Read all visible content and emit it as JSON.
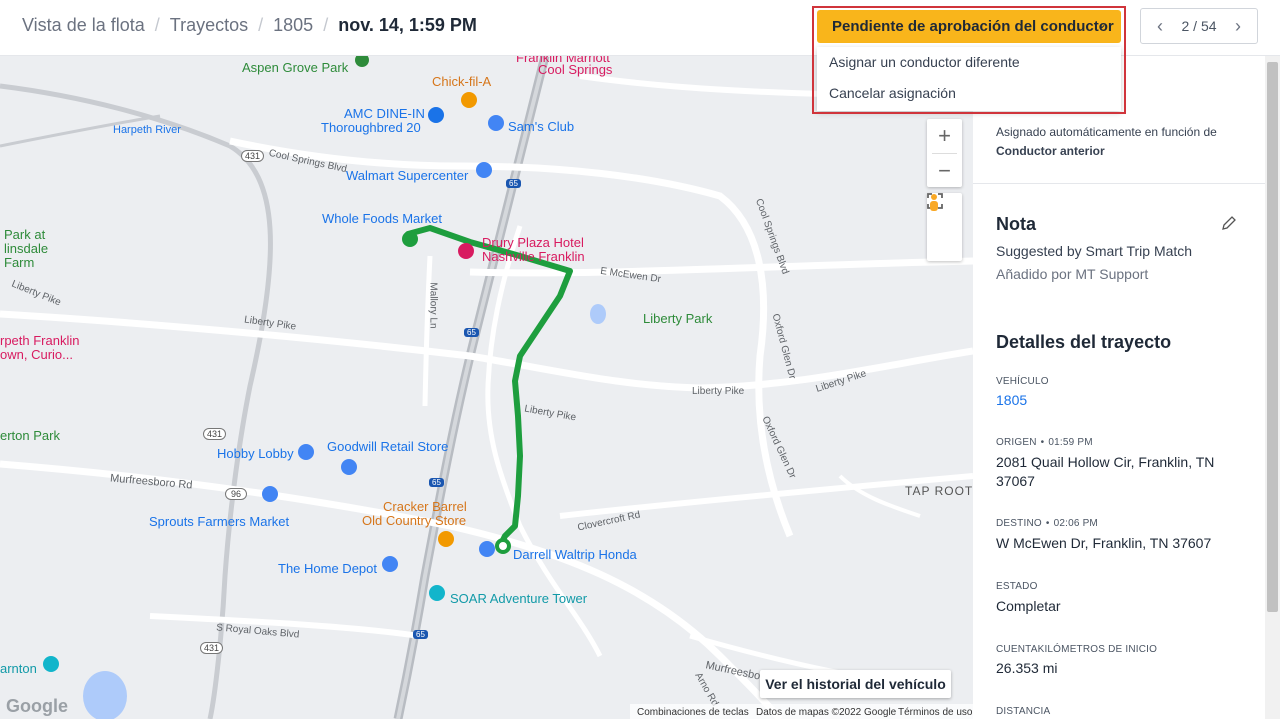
{
  "breadcrumb": {
    "items": [
      "Vista de la flota",
      "Trayectos",
      "1805"
    ],
    "current": "nov. 14, 1:59 PM"
  },
  "status_dropdown": {
    "label": "Pendiente de aprobación del conductor",
    "options": [
      "Asignar un conductor diferente",
      "Cancelar asignación"
    ]
  },
  "pager": {
    "current": "2",
    "total": "54"
  },
  "map": {
    "labels": {
      "aspen_grove_park": "Aspen Grove Park",
      "chick_fil_a": "Chick-fil-A",
      "franklin_marriott": "Franklin Marriott",
      "cool_springs": "Cool Springs",
      "amc_dine_in_1": "AMC DINE-IN",
      "amc_dine_in_2": "Thoroughbred 20",
      "sams_club": "Sam's Club",
      "harpeth_river": "Harpeth River",
      "walmart": "Walmart Supercenter",
      "whole_foods": "Whole Foods Market",
      "drury_plaza_1": "Drury Plaza Hotel",
      "drury_plaza_2": "Nashville Franklin",
      "park_at_1": "Park at",
      "park_at_2": "linsdale",
      "park_at_3": "Farm",
      "liberty_park": "Liberty Park",
      "harpeth_franklin_1": "rpeth Franklin",
      "harpeth_franklin_2": "own, Curio...",
      "erton_park": "erton Park",
      "hobby_lobby": "Hobby Lobby",
      "goodwill": "Goodwill Retail Store",
      "cracker_barrel_1": "Cracker Barrel",
      "cracker_barrel_2": "Old Country Store",
      "sprouts": "Sprouts Farmers Market",
      "darrell_waltrip": "Darrell Waltrip Honda",
      "home_depot": "The Home Depot",
      "soar": "SOAR Adventure Tower",
      "arnton": "arnton",
      "tap_root": "TAP ROOT",
      "cool_springs_blvd": "Cool Springs Blvd",
      "cool_springs_blvd_2": "Cool Springs Blvd",
      "e_mcewen": "E McEwen Dr",
      "mallory_ln": "Mallory Ln",
      "liberty_pike_1": "Liberty Pike",
      "liberty_pike_2": "Liberty Pike",
      "liberty_pike_3": "Liberty Pike",
      "liberty_pike_4": "Liberty Pike",
      "liberty_pike_5": "Liberty Pike",
      "oxford_glen_1": "Oxford Glen Dr",
      "oxford_glen_2": "Oxford Glen Dr",
      "murfreesboro_1": "Murfreesboro Rd",
      "murfreesboro_2": "Murfreesboro",
      "clovercroft": "Clovercroft Rd",
      "s_royal_oaks": "S Royal Oaks Blvd",
      "arno_rd": "Arno Rd",
      "shield_431_a": "431",
      "shield_431_b": "431",
      "shield_431_c": "431",
      "shield_96": "96",
      "shield_65_a": "65",
      "shield_65_b": "65",
      "shield_65_c": "65",
      "shield_65_d": "65"
    },
    "history_button": "Ver el historial del vehículo",
    "footer": {
      "shortcuts": "Combinaciones de teclas",
      "data": "Datos de mapas ©2022 Google",
      "terms": "Términos de uso",
      "logo": "Google"
    },
    "route_color": "#1e9e3e"
  },
  "panel": {
    "assigned_text": "Asignado automáticamente en función de",
    "assigned_basis": "Conductor anterior",
    "note_title": "Nota",
    "note_text": "Suggested by Smart Trip Match",
    "note_added_by": "Añadido por MT Support",
    "details_title": "Detalles del trayecto",
    "vehicle_label": "VEHÍCULO",
    "vehicle_value": "1805",
    "origin_label": "ORIGEN",
    "origin_time": "01:59 PM",
    "origin_value": "2081 Quail Hollow Cir, Franklin, TN 37067",
    "dest_label": "DESTINO",
    "dest_time": "02:06 PM",
    "dest_value": "W McEwen Dr, Franklin, TN 37607",
    "state_label": "ESTADO",
    "state_value": "Completar",
    "odometer_label": "CUENTAKILÓMETROS DE INICIO",
    "odometer_value": "26.353 mi",
    "distance_label": "DISTANCIA"
  },
  "colors": {
    "status_button": "#f9b51b",
    "highlight_border": "#d0343b",
    "link": "#1a73e8",
    "route": "#1e9e3e"
  }
}
